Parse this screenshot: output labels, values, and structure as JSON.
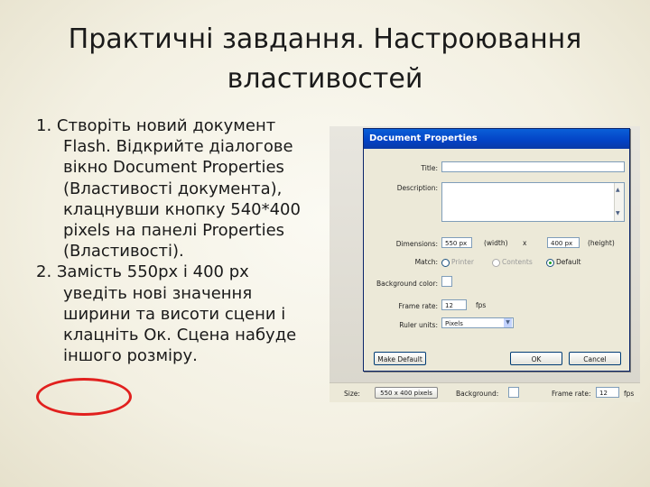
{
  "slide": {
    "title_line1": "Практичні завдання. Настроювання",
    "title_line2": "властивостей",
    "item1": "1. Створіть новий документ Flash. Відкрийте діалогове вікно Document Properties (Властивості документа), клацнувши кнопку 540*400 pixels на панелі Properties (Властивості).",
    "item2": "2. Замість 550px і 400 px уведіть нові значення ширини та висоти сцени і клацніть Ок. Сцена набуде іншого розміру."
  },
  "dialog": {
    "title": "Document Properties",
    "title_label": "Title:",
    "description_label": "Description:",
    "dimensions_label": "Dimensions:",
    "width_value": "550 px",
    "width_caption": "(width)",
    "x_sep": "x",
    "height_value": "400 px",
    "height_caption": "(height)",
    "match_label": "Match:",
    "match_printer": "Printer",
    "match_contents": "Contents",
    "match_default": "Default",
    "bg_color_label": "Background color:",
    "frame_rate_label": "Frame rate:",
    "frame_rate_value": "12",
    "fps_label": "fps",
    "ruler_units_label": "Ruler units:",
    "ruler_units_value": "Pixels",
    "make_default": "Make Default",
    "ok": "OK",
    "cancel": "Cancel"
  },
  "status": {
    "size_label": "Size:",
    "size_button": "550 x 400 pixels",
    "background_label": "Background:",
    "frame_rate_label": "Frame rate:",
    "frame_rate_value": "12",
    "fps": "fps"
  },
  "colors": {
    "highlight_ellipse": "#e1201e",
    "titlebar": "#0342c5"
  }
}
